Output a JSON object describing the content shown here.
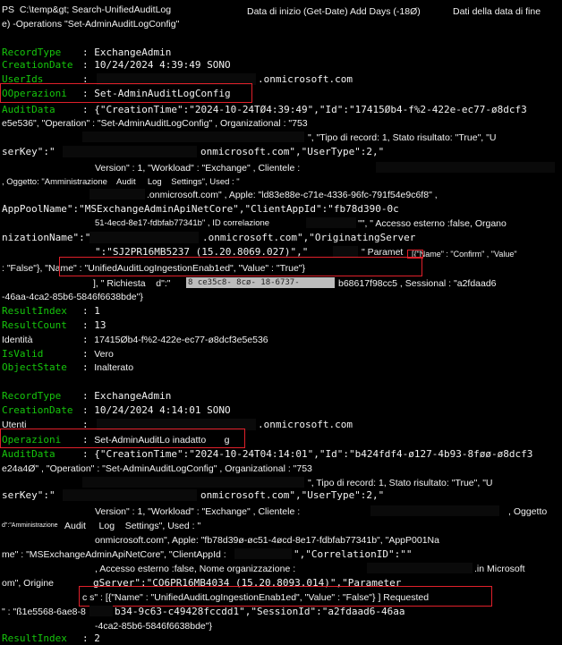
{
  "header": {
    "prompt": "PS  C:\\temp&gt; Search-UnifiedAuditLog",
    "start": "Data di inizio (Get-Date) Add Days (-18Ø)",
    "end": "Dati della data di fine",
    "ops": "e) -Operations \"Set-AdminAuditLogConfig\""
  },
  "r1": {
    "recordtype_k": "RecordType",
    "recordtype_v": "ExchangeAdmin",
    "creation_k": "CreationDate",
    "creation_v": "10/24/2024 4:39:49 SONO",
    "userids_k": "UserIds",
    "userids_v": ".onmicrosoft.com",
    "op_k": "OOperazioni",
    "op_v": "Set-AdminAuditLogConfig",
    "audit_k": "AuditData",
    "a1": "{\"CreationTime\":\"2024-10-24TØ4:39:49\",\"Id\":\"17415Øb4-f%2-422e-ec77-ø8dcf3",
    "a2": "e5e536\", \"Operation\" : \"Set-AdminAuditLogConfig\" , Organizational : \"753",
    "a3": "\", \"Tipo di record: 1, Stato risultato: \"True\", \"U",
    "a4a": "serKey\":\"",
    "a4b": "onmicrosoft.com\",\"UserType\":2,\"",
    "a5": "Version\" : 1, \"Workload\" : \"Exchange\" , Clientele :",
    "a6": ", Oggetto: \"Amministrazione    Audit     Log    Settings\", Used : \"",
    "a7": ".onmicrosoft.com\" , Apple: \"ld83e88e-c71e-4336-96fc-791f54e9c6f8\" ,",
    "a8": "AppPoolName\":\"MSExchangeAdminApiNetCore\",\"ClientAppId\":\"fb78d390-0c",
    "a9a": "51-4ecd-8e17-fdbfab77341b\" , ID correlazione",
    "a9b": "\"\", \" Accesso esterno :false, Organo",
    "a10a": "nizationName\":\"",
    "a10b": ".onmicrosoft.com\",\"OriginatingServer",
    "a11a": "\":\"SJ2PR16MB5237 (15.20.8069.027)\",\"",
    "a11b": "\" Paramet",
    "a11c": "[{\"Name\" : \"Confirm\" , \"Value\"",
    "a12": ": \"False\"}, \"Name\" : \"UnifiedAuditLogIngestionEnab1ed\", \"Value\" : \"True\"}",
    "a13a": "], \" Richiesta    d\":\"",
    "a13gray": "8 ce35c8- 8cø- 18-6737-",
    "a13b": "b68617f98cc5 , Sessional : \"a2fdaad6",
    "a14": "-46aa-4ca2-85b6-5846f6638bde\"}",
    "ri_k": "ResultIndex",
    "ri_v": "1",
    "rc_k": "ResultCount",
    "rc_v": "13",
    "id_k": "Identità",
    "id_v": "17415Øb4-f%2-422e-ec77-ø8dcf3e5e536",
    "iv_k": "IsValid",
    "iv_v": "Vero",
    "os_k": "ObjectState",
    "os_v": "Inalterato"
  },
  "r2": {
    "recordtype_k": "RecordType",
    "recordtype_v": "ExchangeAdmin",
    "creation_k": "CreationDate",
    "creation_v": "10/24/2024 4:14:01 SONO",
    "users_k": "Utenti",
    "users_v": ".onmicrosoft.com",
    "op_k": "Operazioni",
    "op_v": "Set-AdminAuditLo inadatto       g",
    "audit_k": "AuditData",
    "a1": "{\"CreationTime\":\"2024-10-24T04:14:01\",\"Id\":\"b424fdf4-ø127-4b93-8føø-ø8dcf3",
    "a2": "e24a4Ø\" , \"Operation\" : \"Set-AdminAuditLogConfig\" , Organizational : \"753",
    "a3": "\", Tipo di record: 1, Stato risultato: \"True\", \"U",
    "a4a": "serKey\":\"",
    "a4b": "onmicrosoft.com\",\"UserType\":2,\"",
    "a5a": "Version\" : 1, \"Workload\" : \"Exchange\" , Clientele :",
    "a5b": ", Oggetto",
    "a6a": "d\":\"Amministrazione",
    "a6b": "Audit     Log    Settings\", Used : \"",
    "a7": "onmicrosoft.com\", Apple: \"fb78d39ø-øc51-4øcd-8e17-fdbfab77341b\", \"AppP001Na",
    "a8a": "me\" : \"MSExchangeAdminApiNetCore\", \"ClientAppId :",
    "a8b": "\",\"CorrelationID\":\"\"",
    "a9a": ", Accesso esterno :false, Nome organizzazione :",
    "a9b": ".in Microsoft",
    "a10a": "om\", Origine",
    "a10b": "gServer\":\"CO6PR16MB4034 (15.20.8093.014)\",\"Parameter",
    "a11": "c s\" : [{\"Name\" : \"UnifiedAuditLogIngestionEnab1ed\", \"Value\" : \"False\"} ] Requested",
    "a12a": "\" : \"ß1e5568-6ae8-8",
    "a12b": "b34-9c63-c49428fccdd1\",\"SessionId\":\"a2fdaad6-46aa",
    "a13": "-4ca2-85b6-5846f6638bde\"}",
    "ri_k": "ResultIndex",
    "ri_v": "2"
  },
  "colors": {
    "key": "#16c60c",
    "text": "#f2f2f2",
    "highlight": "#e0202a",
    "background": "#000000"
  }
}
